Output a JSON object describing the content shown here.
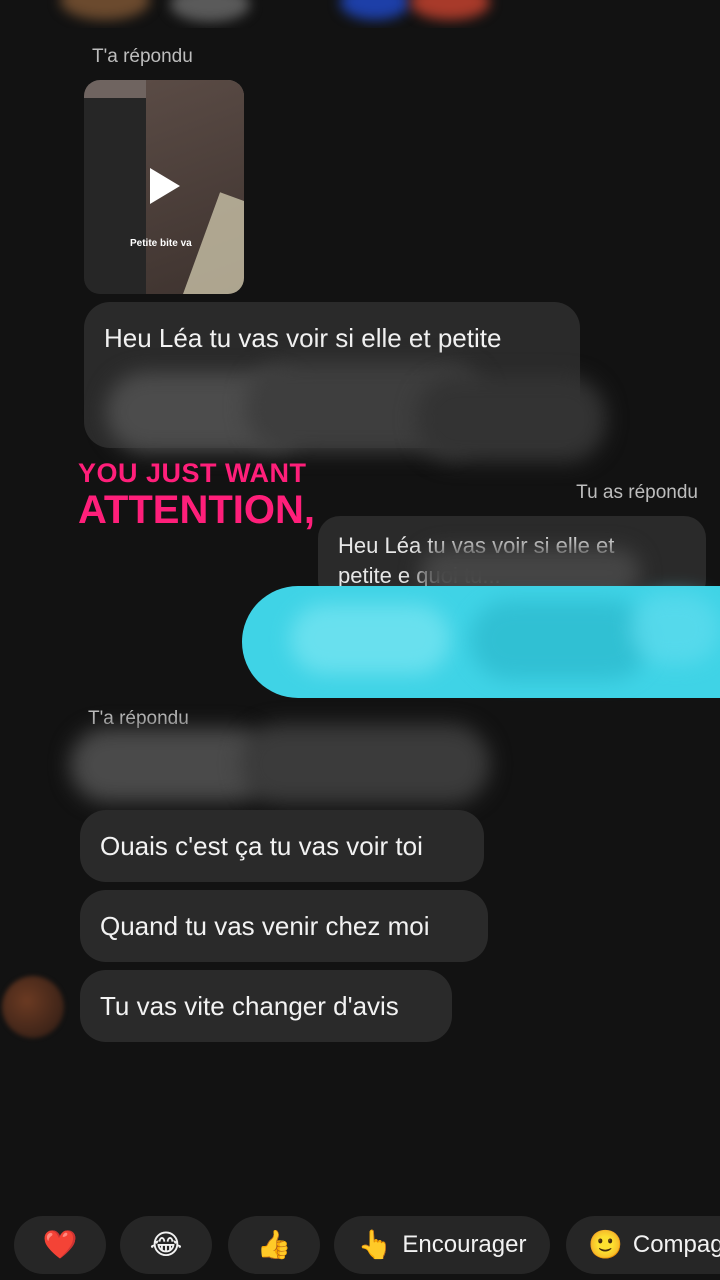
{
  "thread": {
    "reply_label_1": "T'a répondu",
    "video_caption": "Petite bite va",
    "msg_1_line1": "Heu Léa tu vas voir si elle et petite",
    "overlay_line1": "YOU JUST WANT",
    "overlay_line2": "ATTENTION,",
    "reply_label_you": "Tu as répondu",
    "quote_line1": "Heu Léa tu vas voir si elle et",
    "quote_line2": "petite  e                        quoi tu...",
    "reply_label_2": "T'a répondu",
    "msg_2": "Ouais c'est ça tu vas voir toi",
    "msg_3": "Quand tu vas venir chez moi",
    "msg_4": "Tu vas vite changer d'avis"
  },
  "reactions": [
    {
      "icon": "heart-icon",
      "emoji": "❤️",
      "label": ""
    },
    {
      "icon": "laughing-icon",
      "emoji": "😂",
      "label": ""
    },
    {
      "icon": "thumbs-up-icon",
      "emoji": "👍",
      "label": ""
    },
    {
      "icon": "pointing-hand-icon",
      "emoji": "👆",
      "label": "Encourager"
    },
    {
      "icon": "smiling-face-icon",
      "emoji": "🙂",
      "label": "Compag"
    }
  ],
  "colors": {
    "background": "#121212",
    "bubble": "#2a2a2a",
    "overlay_text": "#ff1f7a",
    "highlight": "#3fd3e6"
  }
}
